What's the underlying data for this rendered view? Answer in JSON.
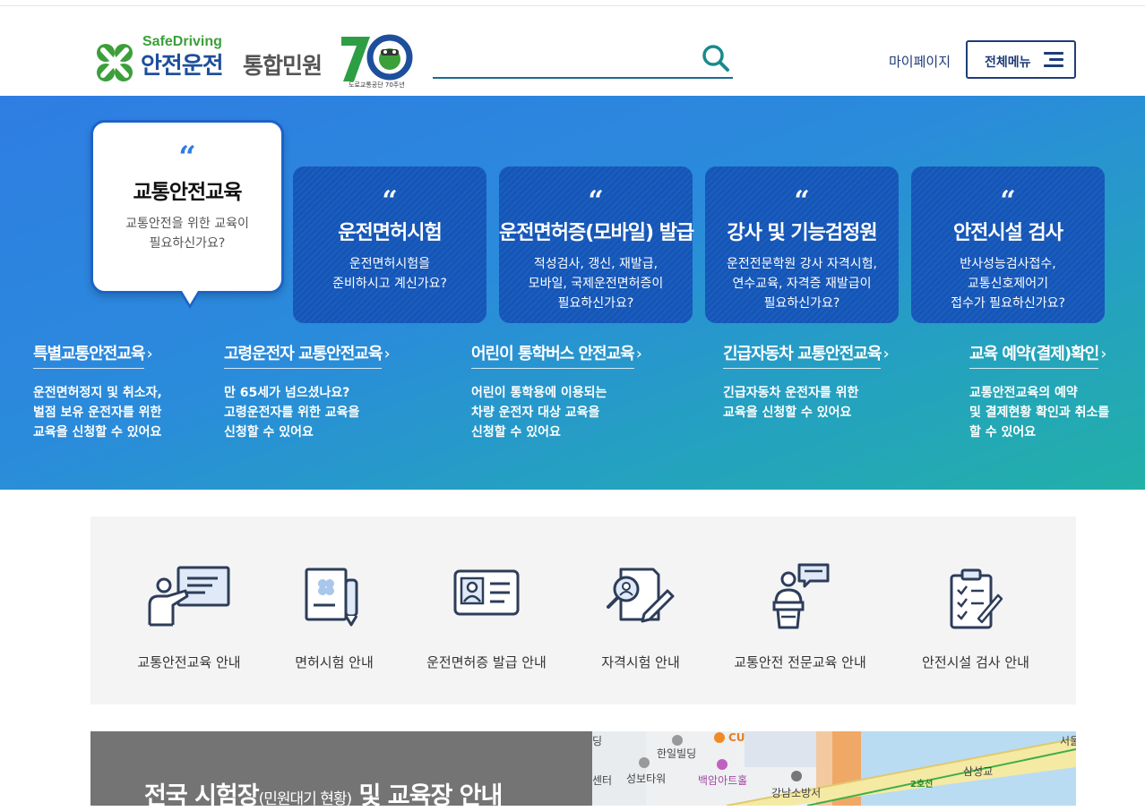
{
  "header": {
    "logo_sub": "SafeDriving",
    "logo_main": "안전운전",
    "logo_main2": "통합민원",
    "anniversary_caption": "도로교통공단 70주년",
    "search_placeholder": "",
    "mypage_label": "마이페이지",
    "allmenu_label": "전체메뉴"
  },
  "hero": {
    "bubble": {
      "quote": "“",
      "title": "교통안전교육",
      "desc1": "교통안전을 위한 교육이",
      "desc2": "필요하신가요?"
    },
    "cards": [
      {
        "quote": "“",
        "title": "운전면허시험",
        "lines": [
          "운전면허시험을",
          "준비하시고 계신가요?"
        ]
      },
      {
        "quote": "“",
        "title": "운전면허증(모바일) 발급",
        "lines": [
          "적성검사, 갱신, 재발급,",
          "모바일, 국제운전면허증이",
          "필요하신가요?"
        ]
      },
      {
        "quote": "“",
        "title": "강사 및 기능검정원",
        "lines": [
          "운전전문학원 강사 자격시험,",
          "연수교육, 자격증 재발급이",
          "필요하신가요?"
        ]
      },
      {
        "quote": "“",
        "title": "안전시설 검사",
        "lines": [
          "반사성능검사접수,",
          "교통신호제어기",
          "접수가 필요하신가요?"
        ]
      }
    ],
    "links": [
      {
        "title": "특별교통안전교육",
        "arrow": "›",
        "lines": [
          "운전면허정지 및 취소자,",
          "벌점 보유 운전자를 위한",
          "교육을 신청할 수 있어요"
        ]
      },
      {
        "title": "고령운전자 교통안전교육",
        "arrow": "›",
        "lines": [
          "만 65세가 넘으셨나요?",
          "고령운전자를 위한 교육을",
          "신청할 수 있어요"
        ]
      },
      {
        "title": "어린이 통학버스 안전교육",
        "arrow": "›",
        "lines": [
          "어린이 통학용에 이용되는",
          "차량 운전자 대상 교육을",
          "신청할 수 있어요"
        ]
      },
      {
        "title": "긴급자동차 교통안전교육",
        "arrow": "›",
        "lines": [
          "긴급자동차 운전자를 위한",
          "교육을 신청할 수 있어요"
        ]
      },
      {
        "title": "교육 예약(결제)확인",
        "arrow": "›",
        "lines": [
          "교통안전교육의 예약",
          "및 결제현황 확인과 취소를",
          "할 수 있어요"
        ]
      }
    ]
  },
  "guide": {
    "items": [
      {
        "label": "교통안전교육 안내",
        "icon": "teacher-board-icon"
      },
      {
        "label": "면허시험 안내",
        "icon": "document-pen-icon"
      },
      {
        "label": "운전면허증 발급 안내",
        "icon": "id-card-icon"
      },
      {
        "label": "자격시험 안내",
        "icon": "magnifier-document-icon"
      },
      {
        "label": "교통안전 전문교육 안내",
        "icon": "lecturer-podium-icon"
      },
      {
        "label": "안전시설 검사 안내",
        "icon": "clipboard-checklist-icon"
      }
    ]
  },
  "exam": {
    "title_a": "전국 시험장",
    "title_small": "(민원대기 현황)",
    "title_b": " 및 교육장 안내"
  },
  "map": {
    "labels": [
      "딩",
      "한일빌딩",
      "CU",
      "백암아트홀",
      "강남소방서",
      "센터",
      "성보타워",
      "삼성교",
      "2호선",
      "서울"
    ]
  },
  "colors": {
    "hero_start": "#2f7de3",
    "hero_end": "#22b0a8",
    "card": "#1456b8",
    "navy": "#1e3c78",
    "clover_green": "#3c9f3a"
  }
}
